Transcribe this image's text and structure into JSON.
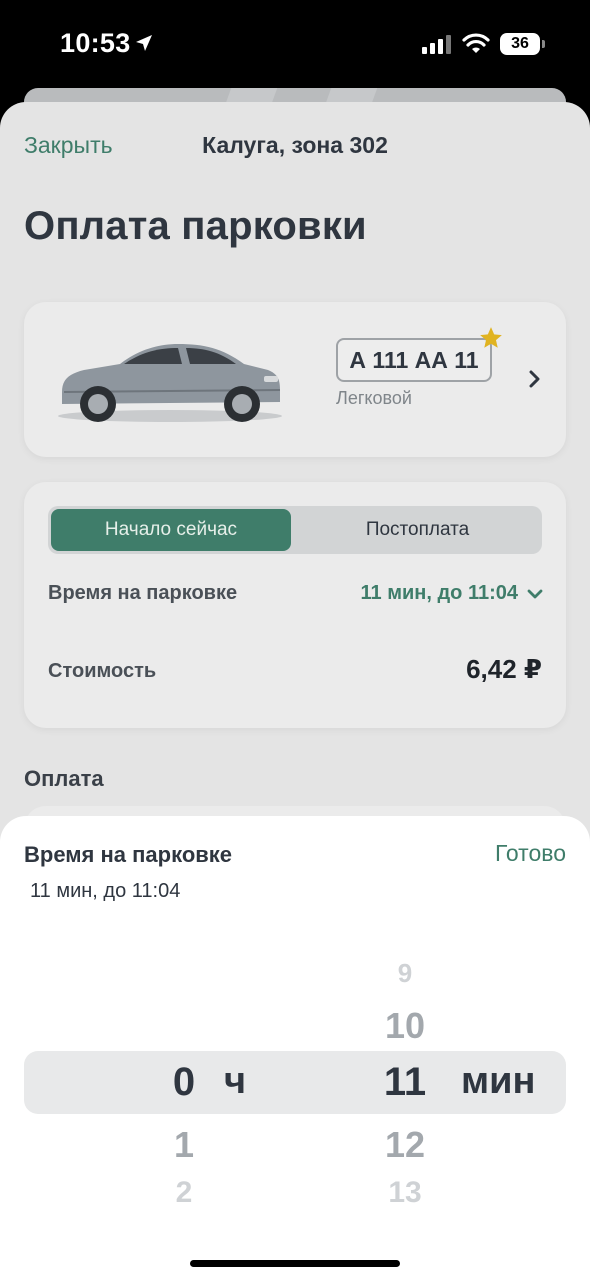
{
  "status_bar": {
    "time": "10:53",
    "battery": "36",
    "icons": [
      "location-arrow-icon",
      "signal-bars-icon",
      "wifi-icon",
      "battery-icon"
    ]
  },
  "header": {
    "close_label": "Закрыть",
    "zone_title": "Калуга, зона 302"
  },
  "page_title": "Оплата парковки",
  "vehicle": {
    "plate": "А 111 АА 11",
    "type": "Легковой",
    "favorite": true
  },
  "timing": {
    "tabs": [
      {
        "label": "Начало сейчас",
        "active": true
      },
      {
        "label": "Постоплата",
        "active": false
      }
    ],
    "parking_time_label": "Время на парковке",
    "parking_time_value": "11 мин, до 11:04",
    "cost_label": "Стоимость",
    "cost_value": "6,42 ₽"
  },
  "payment": {
    "heading": "Оплата"
  },
  "picker": {
    "title": "Время на парковке",
    "done_label": "Готово",
    "summary": "11 мин, до 11:04",
    "hours": {
      "selected": "0",
      "below": [
        "1",
        "2"
      ],
      "unit": "ч"
    },
    "minutes": {
      "above": [
        "9",
        "10"
      ],
      "selected": "11",
      "below": [
        "12",
        "13"
      ],
      "unit": "мин"
    }
  },
  "colors": {
    "accent": "#3f7d6a",
    "star": "#e0b321"
  }
}
